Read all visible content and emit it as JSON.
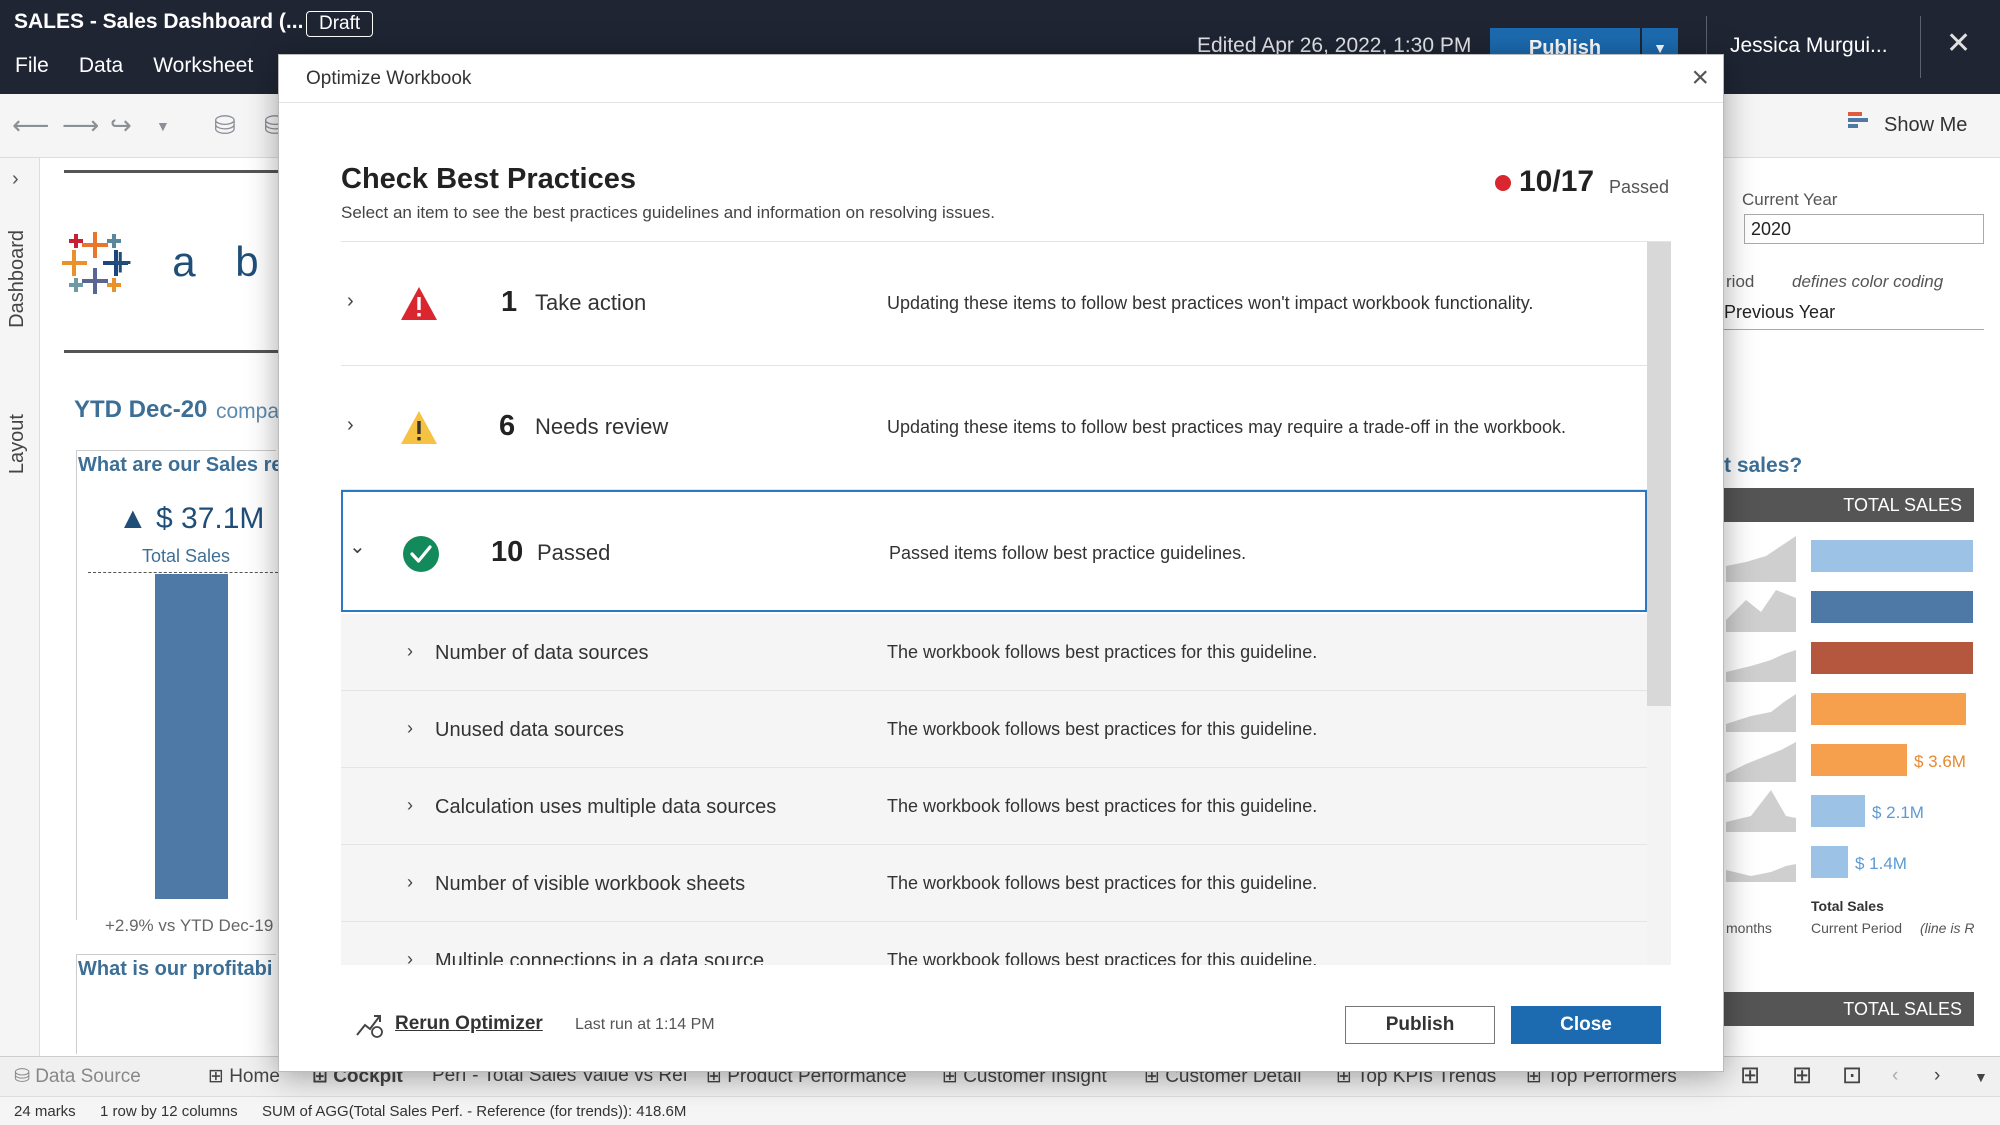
{
  "app": {
    "title": "SALES - Sales Dashboard (...",
    "draft_badge": "Draft",
    "menu": [
      "File",
      "Data",
      "Worksheet"
    ],
    "edited": "Edited Apr 26, 2022, 1:30 PM",
    "publish_label": "Publish",
    "user": "Jessica Murgui..."
  },
  "toolbar": {
    "show_me": "Show Me"
  },
  "side_tabs": {
    "dashboard": "Dashboard",
    "layout": "Layout"
  },
  "dashboard": {
    "logo_text": "+ a b |",
    "ytd_title": "YTD Dec-20",
    "ytd_sub": "compa",
    "q1": "What are our Sales re",
    "q2": "What is our profitabi",
    "kpi_value": "▲ $ 37.1M",
    "kpi_label": "Total Sales",
    "kpi_compare": "+2.9% vs YTD Dec-19",
    "current_year_label": "Current Year",
    "current_year_value": "2020",
    "period_label": "riod",
    "color_coding_label": "defines color coding",
    "period_value": "Previous Year",
    "right_question": "t sales?",
    "total_sales_header": "TOTAL SALES",
    "bar_values": [
      "$ 3.6M",
      "$ 2.1M",
      "$ 1.4M"
    ],
    "axis_label_1": "Total Sales",
    "axis_label_2": "Current Period",
    "axis_label_3": "(line is R",
    "months_label": "months",
    "colors": {
      "light_blue": "#9cc3e5",
      "dark_blue": "#4e79a7",
      "brick": "#b5573e",
      "orange": "#f6a04d"
    }
  },
  "sheet_tabs": [
    "Data Source",
    "Home",
    "Cockpit",
    "Perf - Total Sales Value vs Ref",
    "Product Performance",
    "Customer Insight",
    "Customer Detail",
    "Top KPIs Trends",
    "Top Performers"
  ],
  "status": {
    "marks": "24 marks",
    "dims": "1 row by 12 columns",
    "agg": "SUM of AGG(Total Sales Perf. - Reference (for trends)): 418.6M"
  },
  "modal": {
    "title": "Optimize Workbook",
    "heading": "Check Best Practices",
    "subheading": "Select an item to see the best practices guidelines and information on resolving issues.",
    "score": "10/17",
    "score_label": "Passed",
    "categories": [
      {
        "count": "1",
        "label": "Take action",
        "desc": "Updating these items to follow best practices won't impact workbook functionality.",
        "icon": "error-triangle-icon",
        "color": "#d9262f"
      },
      {
        "count": "6",
        "label": "Needs review",
        "desc": "Updating these items to follow best practices may require a trade-off in the workbook.",
        "icon": "warning-triangle-icon",
        "color": "#f5c243"
      },
      {
        "count": "10",
        "label": "Passed",
        "desc": "Passed items follow best practice guidelines.",
        "icon": "check-circle-icon",
        "color": "#138a5c"
      }
    ],
    "passed_items": [
      {
        "label": "Number of data sources",
        "desc": "The workbook follows best practices for this guideline."
      },
      {
        "label": "Unused data sources",
        "desc": "The workbook follows best practices for this guideline."
      },
      {
        "label": "Calculation uses multiple data sources",
        "desc": "The workbook follows best practices for this guideline."
      },
      {
        "label": "Number of visible workbook sheets",
        "desc": "The workbook follows best practices for this guideline."
      },
      {
        "label": "Multiple connections in a data source",
        "desc": "The workbook follows best practices for this guideline."
      }
    ],
    "rerun_label": "Rerun Optimizer",
    "last_run": "Last run at 1:14 PM",
    "publish_button": "Publish",
    "close_button": "Close"
  }
}
